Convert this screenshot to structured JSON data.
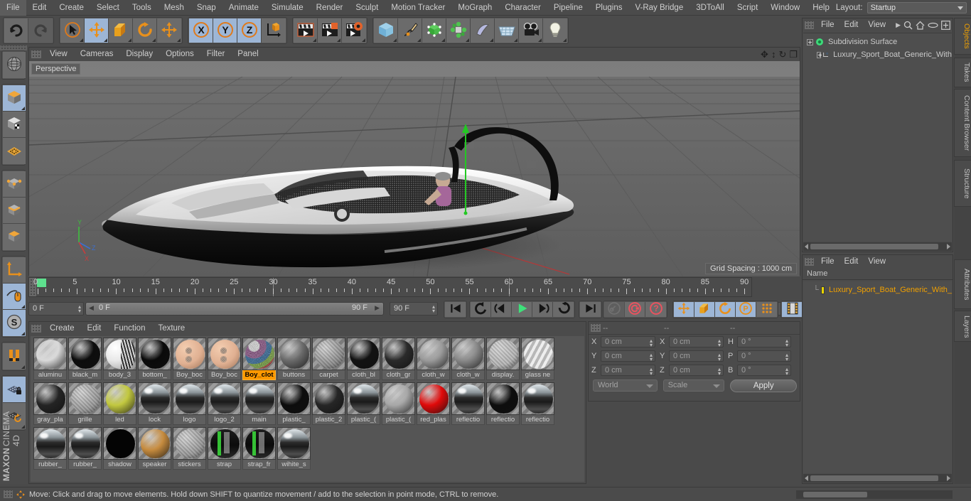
{
  "app": {
    "name": "CINEMA 4D",
    "vendor": "MAXON"
  },
  "menubar": {
    "items": [
      "File",
      "Edit",
      "Create",
      "Select",
      "Tools",
      "Mesh",
      "Snap",
      "Animate",
      "Simulate",
      "Render",
      "Sculpt",
      "Motion Tracker",
      "MoGraph",
      "Character",
      "Pipeline",
      "Plugins",
      "V-Ray Bridge",
      "3DToAll",
      "Script",
      "Window",
      "Help"
    ],
    "layout_label": "Layout:",
    "layout_value": "Startup",
    "search_icon": "magnify-icon"
  },
  "toolbar": {
    "groups": [
      {
        "name": "history",
        "buttons": [
          {
            "icon": "undo-icon",
            "state": "normal"
          },
          {
            "icon": "redo-icon",
            "state": "disabled"
          }
        ]
      },
      {
        "name": "transform",
        "buttons": [
          {
            "icon": "select-live-icon",
            "state": "normal"
          },
          {
            "icon": "move-icon",
            "state": "active"
          },
          {
            "icon": "scale-icon",
            "state": "normal"
          },
          {
            "icon": "rotate-icon",
            "state": "normal"
          },
          {
            "icon": "move-dup-icon",
            "state": "normal"
          }
        ]
      },
      {
        "name": "axis-lock",
        "buttons": [
          {
            "icon": "x-axis-icon",
            "state": "active"
          },
          {
            "icon": "y-axis-icon",
            "state": "active"
          },
          {
            "icon": "z-axis-icon",
            "state": "active"
          },
          {
            "icon": "world-object-axis-icon",
            "state": "normal"
          }
        ]
      },
      {
        "name": "render",
        "buttons": [
          {
            "icon": "render-view-icon",
            "state": "normal"
          },
          {
            "icon": "render-region-icon",
            "state": "normal"
          },
          {
            "icon": "render-settings-icon",
            "state": "normal"
          }
        ]
      },
      {
        "name": "create",
        "buttons": [
          {
            "icon": "cube-primitive-icon",
            "state": "normal"
          },
          {
            "icon": "spline-pen-icon",
            "state": "normal"
          },
          {
            "icon": "nurbs-icon",
            "state": "normal"
          },
          {
            "icon": "array-icon",
            "state": "normal"
          },
          {
            "icon": "deformer-icon",
            "state": "normal"
          },
          {
            "icon": "floor-environment-icon",
            "state": "normal"
          },
          {
            "icon": "camera-icon",
            "state": "normal"
          },
          {
            "icon": "light-icon",
            "state": "normal"
          }
        ]
      }
    ]
  },
  "left_toolbar": {
    "buttons": [
      {
        "icon": "render-globe-icon",
        "state": "normal"
      },
      {
        "icon": "model-mode-icon",
        "state": "active"
      },
      {
        "icon": "texture-mode-icon",
        "state": "normal"
      },
      {
        "icon": "points-mesh-icon",
        "state": "normal"
      },
      {
        "icon": "point-mode-icon",
        "state": "normal"
      },
      {
        "icon": "edge-mode-icon",
        "state": "normal"
      },
      {
        "icon": "polygon-mode-icon",
        "state": "normal"
      },
      {
        "icon": "axis-mode-icon",
        "state": "normal"
      },
      {
        "icon": "viewport-solo-icon",
        "state": "active"
      },
      {
        "icon": "scale-snap-s-icon",
        "state": "active"
      },
      {
        "icon": "magnet-icon",
        "state": "normal"
      },
      {
        "icon": "workplane-lock-icon",
        "state": "active"
      },
      {
        "icon": "workplane-rotate-icon",
        "state": "normal"
      }
    ]
  },
  "viewport": {
    "menu": [
      "View",
      "Cameras",
      "Display",
      "Options",
      "Filter",
      "Panel"
    ],
    "camera_label": "Perspective",
    "grid_spacing": "Grid Spacing : 1000 cm",
    "nav_icons": [
      "pan-icon",
      "dolly-icon",
      "rotate-view-icon",
      "maximize-view-icon"
    ],
    "scene_description": "Luxury sport boat 3D model on perspective grid"
  },
  "timeline": {
    "ruler_start": 0,
    "ruler_end": 90,
    "ruler_labels": [
      "0",
      "5",
      "10",
      "15",
      "20",
      "25",
      "30",
      "35",
      "40",
      "45",
      "50",
      "55",
      "60",
      "65",
      "70",
      "75",
      "80",
      "85",
      "90"
    ],
    "current_frame_field": "0 F",
    "preview_min_field": "0 F",
    "preview_max_field": "90 F",
    "max_frame_field": "90 F",
    "end_frame_field": "0 F",
    "transport_buttons": [
      {
        "icon": "go-to-start-icon",
        "state": "normal"
      },
      {
        "icon": "play-backwards-icon",
        "state": "normal"
      },
      {
        "icon": "step-back-icon",
        "state": "normal"
      },
      {
        "icon": "play-forward-icon",
        "state": "normal"
      },
      {
        "icon": "step-forward-icon",
        "state": "normal"
      },
      {
        "icon": "loop-icon",
        "state": "normal"
      },
      {
        "icon": "go-to-end-icon",
        "state": "normal"
      },
      {
        "icon": "record-key-icon",
        "state": "disabled"
      },
      {
        "icon": "autokey-icon",
        "state": "normal"
      },
      {
        "icon": "keyframe-selection-icon",
        "state": "normal"
      }
    ],
    "key_filter_buttons": [
      {
        "icon": "key-position-icon",
        "state": "active"
      },
      {
        "icon": "key-scale-icon",
        "state": "active"
      },
      {
        "icon": "key-rotation-icon",
        "state": "active"
      },
      {
        "icon": "key-param-icon",
        "state": "active"
      },
      {
        "icon": "key-pla-icon",
        "state": "normal"
      }
    ],
    "timeline_toggle": {
      "icon": "filmstrip-icon",
      "state": "active"
    }
  },
  "materials": {
    "menu": [
      "Create",
      "Edit",
      "Function",
      "Texture"
    ],
    "selected": "Boy_clot",
    "items": [
      {
        "name": "aluminu",
        "color": "#d9d9d9",
        "style": "plain"
      },
      {
        "name": "black_m",
        "color": "#0d0d0d",
        "style": "plain"
      },
      {
        "name": "body_3",
        "color": "#efefef",
        "style": "stripe"
      },
      {
        "name": "bottom_",
        "color": "#0a0a0a",
        "style": "plain"
      },
      {
        "name": "Boy_boc",
        "color": "#e4b596",
        "style": "skin"
      },
      {
        "name": "Boy_boc",
        "color": "#e4b596",
        "style": "skin"
      },
      {
        "name": "Boy_clot",
        "color": "#9a7b8d",
        "style": "noise"
      },
      {
        "name": "buttons",
        "color": "#6b6b6b",
        "style": "plain"
      },
      {
        "name": "carpet",
        "color": "#8e8e8e",
        "style": "rough"
      },
      {
        "name": "cloth_bl",
        "color": "#121212",
        "style": "plain"
      },
      {
        "name": "cloth_gr",
        "color": "#2a2a2a",
        "style": "plain"
      },
      {
        "name": "cloth_w",
        "color": "#9b9b9b",
        "style": "plain"
      },
      {
        "name": "cloth_w",
        "color": "#8a8a8a",
        "style": "plain"
      },
      {
        "name": "display.",
        "color": "#b6b6b6",
        "style": "rough"
      },
      {
        "name": "glass ne",
        "color": "#dedede",
        "style": "glass"
      },
      {
        "name": "gray_pla",
        "color": "#242424",
        "style": "plain"
      },
      {
        "name": "grille",
        "color": "#9a9a9a",
        "style": "rough"
      },
      {
        "name": "led",
        "color": "#c2c83f",
        "style": "plain"
      },
      {
        "name": "lock",
        "color": "#6d6d6d",
        "style": "chrome"
      },
      {
        "name": "logo",
        "color": "#3a3a3a",
        "style": "chrome"
      },
      {
        "name": "logo_2",
        "color": "#6a5a4a",
        "style": "chrome"
      },
      {
        "name": "main",
        "color": "#3a3a3a",
        "style": "chrome"
      },
      {
        "name": "plastic_",
        "color": "#0d0d0d",
        "style": "plain"
      },
      {
        "name": "plastic_2",
        "color": "#262626",
        "style": "plain"
      },
      {
        "name": "plastic_(",
        "color": "#272420",
        "style": "chrome"
      },
      {
        "name": "plastic_(",
        "color": "#a8a8a8",
        "style": "plain"
      },
      {
        "name": "red_plas",
        "color": "#e00a0a",
        "style": "plain"
      },
      {
        "name": "reflectio",
        "color": "#5a5a52",
        "style": "chrome"
      },
      {
        "name": "reflectio",
        "color": "#0e0e0e",
        "style": "plain"
      },
      {
        "name": "reflectio",
        "color": "#b3a48d",
        "style": "chrome"
      },
      {
        "name": "rubber_",
        "color": "#1c1c1c",
        "style": "chrome"
      },
      {
        "name": "rubber_",
        "color": "#1c1c1c",
        "style": "chrome"
      },
      {
        "name": "shadow",
        "color": "#040404",
        "style": "flat"
      },
      {
        "name": "speaker",
        "color": "#c68b3e",
        "style": "plain"
      },
      {
        "name": "stickers",
        "color": "#9b9b9b",
        "style": "rough"
      },
      {
        "name": "strap",
        "color": "#1a1a1a",
        "style": "strap"
      },
      {
        "name": "strap_fr",
        "color": "#1a1a1a",
        "style": "strap"
      },
      {
        "name": "wihite_s",
        "color": "#2a2a2a",
        "style": "chrome"
      }
    ]
  },
  "coordinates": {
    "header_placeholders": [
      "--",
      "--",
      "--"
    ],
    "rows": [
      {
        "pos_axis": "X",
        "pos_value": "0 cm",
        "size_axis": "X",
        "size_value": "0 cm",
        "rot_axis": "H",
        "rot_value": "0 °"
      },
      {
        "pos_axis": "Y",
        "pos_value": "0 cm",
        "size_axis": "Y",
        "size_value": "0 cm",
        "rot_axis": "P",
        "rot_value": "0 °"
      },
      {
        "pos_axis": "Z",
        "pos_value": "0 cm",
        "size_axis": "Z",
        "size_value": "0 cm",
        "rot_axis": "B",
        "rot_value": "0 °"
      }
    ],
    "space_select": "World",
    "mode_select": "Scale",
    "apply_label": "Apply"
  },
  "object_manager": {
    "menu": [
      "File",
      "Edit",
      "View"
    ],
    "icons": [
      "chevron-right-icon",
      "search-icon",
      "home-icon",
      "ellipse-icon",
      "fit-icon"
    ],
    "tree": [
      {
        "label": "Subdivision Surface",
        "icon": "subdivision-surface-icon",
        "depth": 0,
        "selected": false
      },
      {
        "label": "Luxury_Sport_Boat_Generic_With",
        "icon": "null-object-icon",
        "depth": 1,
        "selected": false
      }
    ]
  },
  "layer_manager": {
    "menu": [
      "File",
      "Edit",
      "View"
    ],
    "column_header": "Name",
    "rows": [
      {
        "label": "Luxury_Sport_Boat_Generic_With_",
        "swatch": "#e8d400",
        "selected": true
      }
    ]
  },
  "side_tabs": [
    {
      "label": "Objects",
      "active": true
    },
    {
      "label": "Takes",
      "active": false
    },
    {
      "label": "Content Browser",
      "active": false
    },
    {
      "label": "Structure",
      "active": false
    },
    {
      "label": "Attributes",
      "active": false
    },
    {
      "label": "Layers",
      "active": false
    }
  ],
  "statusbar": {
    "message": "Move: Click and drag to move elements. Hold down SHIFT to quantize movement / add to the selection in point mode, CTRL to remove."
  },
  "colors": {
    "chrome_panel": "#4b4b4b",
    "button": "#6b6b6b",
    "active_button": "#9db6d6",
    "accent_orange": "#ff9900",
    "selection_orange": "#f0a000",
    "viewport_bg": "#6e6e6e",
    "green_marker": "#5ee08e"
  }
}
